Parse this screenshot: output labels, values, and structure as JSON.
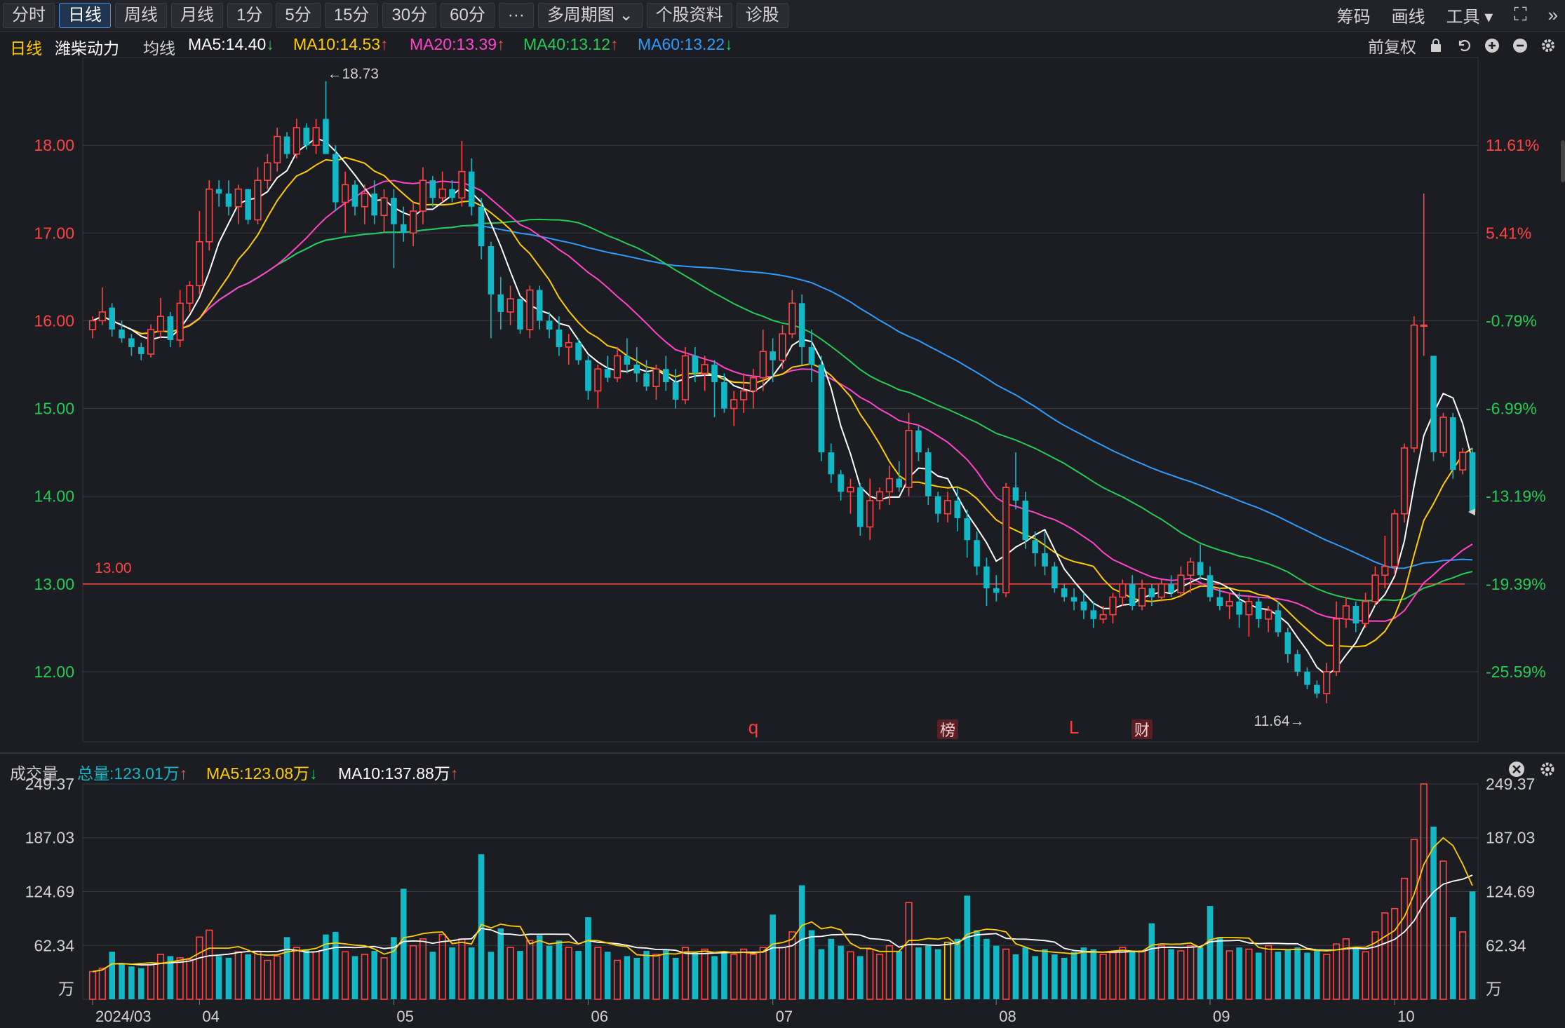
{
  "toolbar": {
    "tabs": [
      {
        "label": "分时",
        "active": false
      },
      {
        "label": "日线",
        "active": true
      },
      {
        "label": "周线",
        "active": false
      },
      {
        "label": "月线",
        "active": false
      },
      {
        "label": "1分",
        "active": false
      },
      {
        "label": "5分",
        "active": false
      },
      {
        "label": "15分",
        "active": false
      },
      {
        "label": "30分",
        "active": false
      },
      {
        "label": "60分",
        "active": false
      },
      {
        "label": "···",
        "active": false
      },
      {
        "label": "多周期图 ⌄",
        "active": false
      },
      {
        "label": "个股资料",
        "active": false
      },
      {
        "label": "诊股",
        "active": false
      }
    ],
    "right": {
      "chip": "筹码",
      "draw": "画线",
      "tools": "工具 ▾",
      "fullscreen": "⛶",
      "expand": "»"
    }
  },
  "legend": {
    "period": "日线",
    "stock": "潍柴动力",
    "ma_label": "均线",
    "ma5": "MA5:14.40",
    "ma10": "MA10:14.53",
    "ma20": "MA20:13.39",
    "ma40": "MA40:13.12",
    "ma60": "MA60:13.22",
    "ma5_arrow": "↓",
    "ma10_arrow": "↑",
    "ma20_arrow": "↑",
    "ma40_arrow": "↑",
    "ma60_arrow": "↓",
    "adjust": "前复权"
  },
  "volume_legend": {
    "title": "成交量",
    "total": "总量:123.01万",
    "total_arrow": "↑",
    "ma5": "MA5:123.08万",
    "ma5_arrow": "↓",
    "ma10": "MA10:137.88万",
    "ma10_arrow": "↑"
  },
  "colors": {
    "up": "#ff4444",
    "down": "#12b8c6",
    "ma5": "#ffffff",
    "ma10": "#ffcc00",
    "ma20": "#ff44cc",
    "ma40": "#22cc55",
    "ma60": "#2e9cff",
    "grid": "#3a3c44",
    "axis_red": "#ff4444",
    "axis_green": "#22cc55",
    "hline": "#ff4444"
  },
  "chart_data": [
    {
      "type": "candlestick",
      "title": "潍柴动力 日线",
      "ylim": [
        11.2,
        19.0
      ],
      "y_ticks": [
        12.0,
        13.0,
        14.0,
        15.0,
        16.0,
        17.0,
        18.0
      ],
      "y_tick_labels": [
        "12.00",
        "13.00",
        "14.00",
        "15.00",
        "16.00",
        "17.00",
        "18.00"
      ],
      "right_ticks": [
        {
          "price": 18.0,
          "label": "11.61%"
        },
        {
          "price": 17.0,
          "label": "5.41%"
        },
        {
          "price": 16.0,
          "label": "-0.79%"
        },
        {
          "price": 15.0,
          "label": "-6.99%"
        },
        {
          "price": 14.0,
          "label": "-13.19%"
        },
        {
          "price": 13.0,
          "label": "-19.39%"
        },
        {
          "price": 12.0,
          "label": "-25.59%"
        }
      ],
      "x_labels": [
        {
          "index": 0,
          "label": "2024/03"
        },
        {
          "index": 11,
          "label": "04"
        },
        {
          "index": 31,
          "label": "05"
        },
        {
          "index": 51,
          "label": "06"
        },
        {
          "index": 70,
          "label": "07"
        },
        {
          "index": 93,
          "label": "08"
        },
        {
          "index": 115,
          "label": "09"
        },
        {
          "index": 134,
          "label": "10"
        }
      ],
      "hline": {
        "price": 13.0,
        "label": "13.00"
      },
      "max_label": {
        "index": 24,
        "price": 18.73,
        "label": "←18.73"
      },
      "min_label": {
        "index": 125,
        "price": 11.64,
        "label": "11.64→"
      },
      "markers": [
        {
          "index": 68,
          "label": "q",
          "boxed": false
        },
        {
          "index": 88,
          "label": "榜",
          "boxed": true
        },
        {
          "index": 101,
          "label": "L",
          "boxed": false
        },
        {
          "index": 108,
          "label": "财",
          "boxed": true
        }
      ],
      "ma_lines": [
        "MA5",
        "MA10",
        "MA20",
        "MA40",
        "MA60"
      ],
      "ohlc": [
        [
          15.9,
          16.05,
          15.8,
          16.0
        ],
        [
          16.0,
          16.38,
          15.95,
          16.1
        ],
        [
          16.15,
          16.2,
          15.82,
          15.9
        ],
        [
          15.9,
          16.0,
          15.75,
          15.8
        ],
        [
          15.8,
          15.85,
          15.6,
          15.7
        ],
        [
          15.7,
          15.75,
          15.55,
          15.62
        ],
        [
          15.62,
          15.96,
          15.58,
          15.9
        ],
        [
          15.88,
          16.26,
          15.8,
          16.05
        ],
        [
          16.05,
          16.1,
          15.7,
          15.78
        ],
        [
          15.78,
          16.35,
          15.7,
          16.2
        ],
        [
          16.2,
          16.45,
          16.1,
          16.4
        ],
        [
          16.4,
          17.25,
          16.3,
          16.9
        ],
        [
          16.9,
          17.6,
          16.8,
          17.5
        ],
        [
          17.5,
          17.6,
          17.3,
          17.45
        ],
        [
          17.45,
          17.6,
          17.2,
          17.3
        ],
        [
          17.3,
          17.55,
          17.1,
          17.5
        ],
        [
          17.5,
          17.5,
          17.1,
          17.15
        ],
        [
          17.15,
          17.75,
          17.1,
          17.6
        ],
        [
          17.6,
          17.9,
          17.5,
          17.8
        ],
        [
          17.8,
          18.2,
          17.7,
          18.1
        ],
        [
          18.1,
          18.15,
          17.85,
          17.9
        ],
        [
          17.9,
          18.3,
          17.85,
          18.2
        ],
        [
          18.2,
          18.25,
          17.95,
          18.0
        ],
        [
          18.0,
          18.3,
          17.9,
          18.2
        ],
        [
          18.3,
          18.73,
          17.9,
          17.9
        ],
        [
          17.9,
          18.0,
          17.25,
          17.35
        ],
        [
          17.35,
          17.7,
          17.0,
          17.55
        ],
        [
          17.55,
          17.6,
          17.2,
          17.3
        ],
        [
          17.3,
          17.55,
          17.1,
          17.45
        ],
        [
          17.45,
          17.6,
          17.1,
          17.2
        ],
        [
          17.2,
          17.5,
          17.0,
          17.4
        ],
        [
          17.4,
          17.5,
          16.6,
          17.1
        ],
        [
          17.1,
          17.3,
          16.9,
          17.0
        ],
        [
          17.0,
          17.35,
          16.85,
          17.25
        ],
        [
          17.25,
          17.75,
          17.1,
          17.6
        ],
        [
          17.6,
          17.65,
          17.3,
          17.4
        ],
        [
          17.4,
          17.7,
          17.35,
          17.5
        ],
        [
          17.5,
          17.6,
          17.35,
          17.4
        ],
        [
          17.4,
          18.05,
          17.3,
          17.7
        ],
        [
          17.7,
          17.85,
          17.2,
          17.3
        ],
        [
          17.3,
          17.4,
          16.7,
          16.85
        ],
        [
          16.85,
          16.9,
          15.8,
          16.3
        ],
        [
          16.3,
          16.5,
          15.9,
          16.1
        ],
        [
          16.1,
          16.4,
          15.95,
          16.25
        ],
        [
          16.25,
          16.25,
          15.85,
          15.9
        ],
        [
          15.9,
          16.4,
          15.8,
          16.35
        ],
        [
          16.35,
          16.4,
          15.9,
          16.0
        ],
        [
          16.0,
          16.1,
          15.8,
          15.9
        ],
        [
          15.9,
          16.05,
          15.6,
          15.7
        ],
        [
          15.7,
          15.85,
          15.5,
          15.75
        ],
        [
          15.75,
          15.8,
          15.5,
          15.55
        ],
        [
          15.55,
          15.6,
          15.1,
          15.2
        ],
        [
          15.2,
          15.5,
          15.0,
          15.45
        ],
        [
          15.45,
          15.6,
          15.3,
          15.35
        ],
        [
          15.35,
          15.7,
          15.3,
          15.6
        ],
        [
          15.6,
          15.8,
          15.4,
          15.5
        ],
        [
          15.5,
          15.7,
          15.3,
          15.4
        ],
        [
          15.4,
          15.55,
          15.2,
          15.25
        ],
        [
          15.25,
          15.5,
          15.1,
          15.45
        ],
        [
          15.45,
          15.6,
          15.2,
          15.3
        ],
        [
          15.3,
          15.45,
          15.0,
          15.1
        ],
        [
          15.1,
          15.7,
          15.05,
          15.6
        ],
        [
          15.6,
          15.7,
          15.3,
          15.4
        ],
        [
          15.4,
          15.6,
          15.2,
          15.5
        ],
        [
          15.5,
          15.55,
          14.9,
          15.3
        ],
        [
          15.3,
          15.4,
          14.95,
          15.0
        ],
        [
          15.0,
          15.2,
          14.8,
          15.1
        ],
        [
          15.1,
          15.4,
          14.95,
          15.2
        ],
        [
          15.2,
          15.45,
          15.0,
          15.35
        ],
        [
          15.35,
          15.9,
          15.2,
          15.65
        ],
        [
          15.65,
          15.8,
          15.3,
          15.55
        ],
        [
          15.55,
          15.95,
          15.45,
          15.85
        ],
        [
          15.85,
          16.35,
          15.8,
          16.2
        ],
        [
          16.2,
          16.3,
          15.5,
          15.7
        ],
        [
          15.7,
          15.9,
          15.3,
          15.5
        ],
        [
          15.5,
          15.6,
          14.4,
          14.5
        ],
        [
          14.5,
          14.6,
          14.15,
          14.25
        ],
        [
          14.25,
          14.3,
          13.95,
          14.05
        ],
        [
          14.05,
          14.2,
          13.8,
          14.1
        ],
        [
          14.1,
          14.15,
          13.55,
          13.65
        ],
        [
          13.65,
          14.2,
          13.5,
          13.95
        ],
        [
          13.95,
          14.1,
          13.85,
          14.05
        ],
        [
          14.05,
          14.35,
          13.9,
          14.2
        ],
        [
          14.2,
          14.4,
          14.05,
          14.1
        ],
        [
          14.1,
          14.95,
          14.0,
          14.75
        ],
        [
          14.75,
          14.8,
          14.4,
          14.5
        ],
        [
          14.5,
          14.55,
          13.9,
          14.0
        ],
        [
          14.0,
          14.05,
          13.7,
          13.8
        ],
        [
          13.8,
          14.05,
          13.7,
          13.95
        ],
        [
          13.95,
          14.1,
          13.6,
          13.75
        ],
        [
          13.75,
          13.85,
          13.3,
          13.5
        ],
        [
          13.5,
          13.6,
          13.1,
          13.2
        ],
        [
          13.2,
          13.3,
          12.75,
          12.95
        ],
        [
          12.95,
          13.1,
          12.8,
          12.9
        ],
        [
          12.9,
          14.15,
          12.85,
          14.1
        ],
        [
          14.1,
          14.5,
          13.85,
          13.95
        ],
        [
          13.95,
          14.05,
          13.4,
          13.5
        ],
        [
          13.5,
          13.6,
          13.2,
          13.35
        ],
        [
          13.35,
          13.6,
          13.1,
          13.2
        ],
        [
          13.2,
          13.25,
          12.9,
          12.95
        ],
        [
          12.95,
          13.0,
          12.8,
          12.85
        ],
        [
          12.85,
          12.95,
          12.7,
          12.8
        ],
        [
          12.8,
          12.9,
          12.6,
          12.7
        ],
        [
          12.7,
          12.8,
          12.5,
          12.6
        ],
        [
          12.6,
          12.75,
          12.55,
          12.65
        ],
        [
          12.65,
          12.9,
          12.55,
          12.85
        ],
        [
          12.85,
          13.05,
          12.75,
          13.0
        ],
        [
          13.0,
          13.1,
          12.7,
          12.75
        ],
        [
          12.75,
          13.05,
          12.7,
          12.95
        ],
        [
          12.95,
          13.0,
          12.75,
          12.85
        ],
        [
          12.85,
          13.05,
          12.8,
          13.0
        ],
        [
          13.0,
          13.1,
          12.85,
          12.9
        ],
        [
          12.9,
          13.2,
          12.85,
          13.1
        ],
        [
          13.1,
          13.3,
          12.9,
          13.25
        ],
        [
          13.25,
          13.45,
          13.05,
          13.1
        ],
        [
          13.1,
          13.2,
          12.8,
          12.85
        ],
        [
          12.85,
          12.95,
          12.7,
          12.75
        ],
        [
          12.75,
          12.9,
          12.6,
          12.8
        ],
        [
          12.8,
          12.9,
          12.5,
          12.65
        ],
        [
          12.65,
          12.85,
          12.4,
          12.8
        ],
        [
          12.8,
          12.85,
          12.5,
          12.6
        ],
        [
          12.6,
          12.75,
          12.45,
          12.7
        ],
        [
          12.7,
          12.8,
          12.4,
          12.45
        ],
        [
          12.45,
          12.5,
          12.1,
          12.2
        ],
        [
          12.2,
          12.25,
          11.95,
          12.0
        ],
        [
          12.0,
          12.05,
          11.8,
          11.85
        ],
        [
          11.85,
          11.9,
          11.7,
          11.75
        ],
        [
          11.75,
          12.1,
          11.64,
          12.0
        ],
        [
          12.0,
          12.8,
          11.95,
          12.6
        ],
        [
          12.6,
          12.85,
          12.5,
          12.75
        ],
        [
          12.75,
          12.8,
          12.45,
          12.55
        ],
        [
          12.55,
          12.9,
          12.5,
          12.8
        ],
        [
          12.8,
          13.2,
          12.75,
          13.1
        ],
        [
          13.1,
          13.55,
          12.95,
          13.2
        ],
        [
          13.2,
          13.85,
          13.1,
          13.8
        ],
        [
          13.8,
          14.6,
          13.7,
          14.55
        ],
        [
          14.55,
          16.05,
          14.5,
          15.95
        ],
        [
          15.95,
          17.45,
          15.6,
          15.95
        ],
        [
          15.6,
          15.6,
          14.4,
          14.5
        ],
        [
          14.5,
          14.95,
          14.45,
          14.9
        ],
        [
          14.9,
          14.95,
          14.2,
          14.3
        ],
        [
          14.3,
          14.55,
          14.25,
          14.5
        ],
        [
          14.5,
          14.55,
          13.8,
          13.82
        ]
      ]
    },
    {
      "type": "bar",
      "title": "成交量",
      "unit": "万",
      "ylim": [
        0,
        249.37
      ],
      "y_ticks": [
        62.34,
        124.69,
        187.03,
        249.37
      ],
      "y_tick_labels": [
        "62.34",
        "124.69",
        "187.03",
        "249.37"
      ],
      "boxed_index": 88,
      "values": [
        32,
        36,
        55,
        42,
        38,
        36,
        40,
        52,
        50,
        48,
        46,
        72,
        80,
        50,
        48,
        55,
        52,
        55,
        45,
        50,
        72,
        60,
        58,
        55,
        75,
        78,
        55,
        50,
        52,
        56,
        48,
        72,
        128,
        62,
        70,
        55,
        75,
        60,
        70,
        60,
        168,
        55,
        82,
        60,
        56,
        68,
        74,
        62,
        68,
        60,
        56,
        95,
        60,
        55,
        45,
        50,
        48,
        56,
        52,
        58,
        48,
        60,
        55,
        58,
        50,
        54,
        52,
        58,
        52,
        60,
        98,
        60,
        78,
        132,
        80,
        58,
        70,
        62,
        55,
        50,
        58,
        52,
        62,
        56,
        112,
        60,
        62,
        58,
        66,
        70,
        120,
        80,
        70,
        62,
        58,
        52,
        60,
        50,
        58,
        52,
        48,
        55,
        60,
        58,
        52,
        54,
        60,
        55,
        56,
        88,
        62,
        58,
        56,
        62,
        60,
        108,
        72,
        56,
        60,
        58,
        54,
        62,
        55,
        58,
        60,
        54,
        56,
        52,
        64,
        70,
        60,
        55,
        78,
        100,
        105,
        140,
        185,
        250,
        200,
        160,
        95,
        78,
        125
      ]
    }
  ]
}
